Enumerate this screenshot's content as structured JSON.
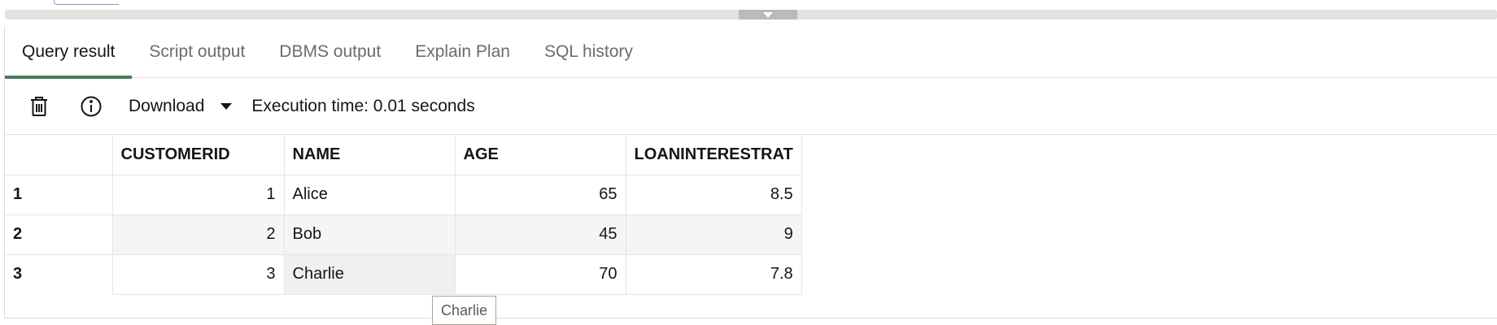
{
  "tabs": [
    {
      "label": "Query result",
      "active": true
    },
    {
      "label": "Script output",
      "active": false
    },
    {
      "label": "DBMS output",
      "active": false
    },
    {
      "label": "Explain Plan",
      "active": false
    },
    {
      "label": "SQL history",
      "active": false
    }
  ],
  "toolbar": {
    "delete_icon": "trash-icon",
    "info_icon": "info-icon",
    "download_label": "Download",
    "execution_time": "Execution time: 0.01 seconds"
  },
  "grid": {
    "columns": [
      "CUSTOMERID",
      "NAME",
      "AGE",
      "LOANINTERESTRAT"
    ],
    "rows": [
      {
        "rownum": "1",
        "customerid": "1",
        "name": "Alice",
        "age": "65",
        "rate": "8.5"
      },
      {
        "rownum": "2",
        "customerid": "2",
        "name": "Bob",
        "age": "45",
        "rate": "9"
      },
      {
        "rownum": "3",
        "customerid": "3",
        "name": "Charlie",
        "age": "70",
        "rate": "7.8"
      }
    ]
  },
  "tooltip": {
    "text": "Charlie"
  },
  "colors": {
    "accent": "#4b7a5b",
    "splitter": "#bdb9b4"
  }
}
